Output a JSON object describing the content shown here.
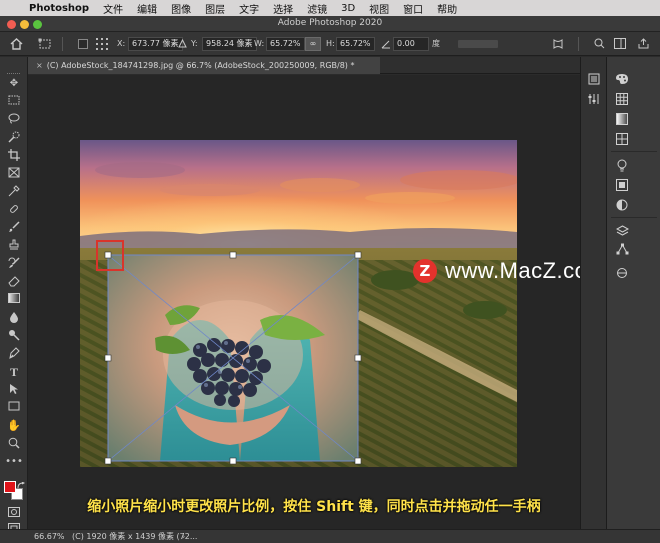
{
  "menubar": {
    "app": "Photoshop",
    "items": [
      "文件",
      "编辑",
      "图像",
      "图层",
      "文字",
      "选择",
      "滤镜",
      "3D",
      "视图",
      "窗口",
      "帮助"
    ]
  },
  "window": {
    "title": "Adobe Photoshop 2020"
  },
  "options": {
    "x_label": "X:",
    "x_value": "673.77 像素",
    "y_label": "Y:",
    "y_value": "958.24 像素",
    "w_label": "W:",
    "w_value": "65.72%",
    "h_label": "H:",
    "h_value": "65.72%",
    "angle_value": "0.00",
    "angle_unit": "度"
  },
  "document": {
    "tab_title": "(C) AdobeStock_184741298.jpg @ 66.7% (AdobeStock_200250009, RGB/8) *"
  },
  "status": {
    "zoom": "66.67%",
    "info": "(C) 1920 像素 x 1439 像素 (72..."
  },
  "watermark": {
    "text": "www.MacZ.com",
    "logo": "Z"
  },
  "caption": "缩小照片缩小时更改照片比例，按住 Shift 键，同时点击并拖动任一手柄",
  "colors": {
    "foreground": "#e0141a",
    "background": "#ffffff",
    "highlight": "#d9342b",
    "caption": "#ffe24a"
  },
  "toolbar_icons": [
    "move-icon",
    "marquee-icon",
    "lasso-icon",
    "quick-select-icon",
    "crop-icon",
    "frame-icon",
    "eyedropper-icon",
    "healing-icon",
    "brush-icon",
    "stamp-icon",
    "history-brush-icon",
    "eraser-icon",
    "gradient-icon",
    "blur-icon",
    "dodge-icon",
    "pen-icon",
    "type-icon",
    "path-select-icon",
    "rectangle-icon",
    "hand-icon",
    "zoom-icon",
    "more-icon"
  ]
}
